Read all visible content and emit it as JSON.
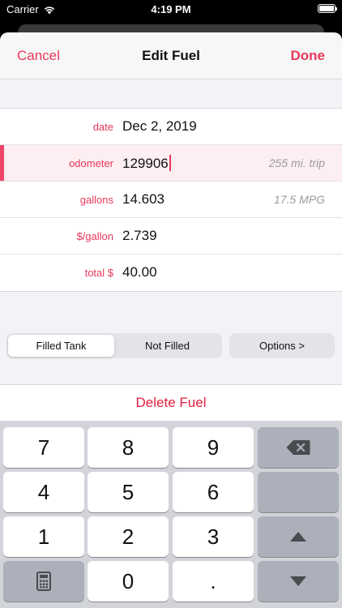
{
  "status": {
    "carrier": "Carrier",
    "time": "4:19 PM",
    "battery_level": 1.0,
    "icons": [
      "wifi-icon",
      "battery-icon"
    ]
  },
  "nav": {
    "left": "Cancel",
    "title": "Edit Fuel",
    "right": "Done"
  },
  "form": {
    "rows": [
      {
        "label": "date",
        "value": "Dec 2, 2019",
        "hint": ""
      },
      {
        "label": "odometer",
        "value": "129906",
        "hint": "255 mi. trip"
      },
      {
        "label": "gallons",
        "value": "14.603",
        "hint": "17.5 MPG"
      },
      {
        "label": "$/gallon",
        "value": "2.739",
        "hint": ""
      },
      {
        "label": "total $",
        "value": "40.00",
        "hint": ""
      }
    ]
  },
  "fill": {
    "options": [
      "Filled Tank",
      "Not Filled"
    ],
    "selected": "Filled Tank",
    "options_button": "Options >"
  },
  "delete_label": "Delete Fuel",
  "keypad": {
    "keys": [
      "7",
      "8",
      "9",
      "4",
      "5",
      "6",
      "1",
      "2",
      "3",
      "0",
      "."
    ],
    "icons": [
      "delete-backward-icon",
      "arrow-up-icon",
      "arrow-down-icon",
      "calculator-icon"
    ]
  },
  "colors": {
    "accent": "#e8385a",
    "destructive": "#e01f3d",
    "active_row_bg": "#fdeef1"
  }
}
